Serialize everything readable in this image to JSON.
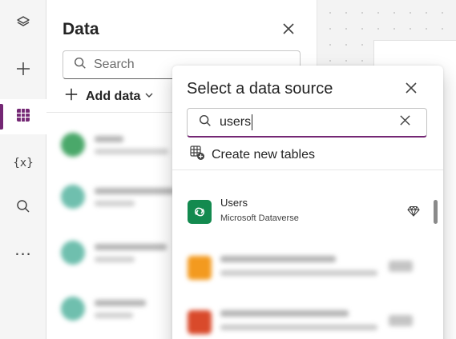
{
  "rail": {
    "items": [
      {
        "icon": "layers-icon",
        "active": false
      },
      {
        "icon": "plus-icon",
        "active": false
      },
      {
        "icon": "table-grid-icon",
        "active": true
      },
      {
        "icon": "variables-icon",
        "label": "{x}",
        "active": false
      },
      {
        "icon": "search-icon",
        "active": false
      },
      {
        "icon": "more-icon",
        "label": "...",
        "active": false
      }
    ]
  },
  "data_panel": {
    "title": "Data",
    "search_placeholder": "Search",
    "add_data_label": "Add data"
  },
  "popup": {
    "title": "Select a data source",
    "search_value": "users",
    "create_tables_label": "Create new tables",
    "results": [
      {
        "name": "Users",
        "source": "Microsoft Dataverse",
        "icon": "dataverse-icon",
        "premium": true
      }
    ]
  },
  "colors": {
    "accent": "#742774",
    "dataverse_green": "#138a4f"
  }
}
